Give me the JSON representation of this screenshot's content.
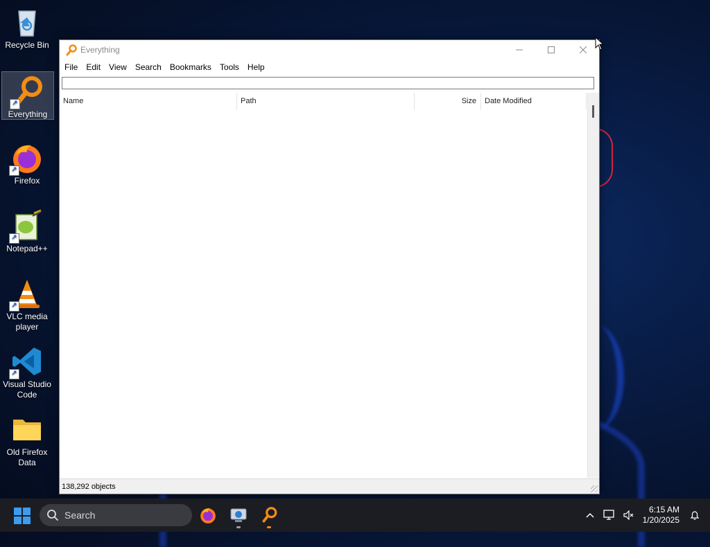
{
  "desktop": {
    "icons": [
      {
        "label": "Recycle Bin",
        "icon": "recycle-bin-icon"
      },
      {
        "label": "Everything",
        "icon": "everything-icon"
      },
      {
        "label": "Firefox",
        "icon": "firefox-icon"
      },
      {
        "label": "Notepad++",
        "icon": "notepadpp-icon"
      },
      {
        "label": "VLC media player",
        "icon": "vlc-icon"
      },
      {
        "label": "Visual Studio Code",
        "icon": "vscode-icon"
      },
      {
        "label": "Old Firefox Data",
        "icon": "folder-icon"
      }
    ]
  },
  "window": {
    "title": "Everything",
    "menu": [
      "File",
      "Edit",
      "View",
      "Search",
      "Bookmarks",
      "Tools",
      "Help"
    ],
    "search": {
      "value": "",
      "placeholder": ""
    },
    "columns": [
      "Name",
      "Path",
      "Size",
      "Date Modified"
    ],
    "status": "138,292 objects"
  },
  "taskbar": {
    "search_label": "Search",
    "apps": [
      "firefox-icon",
      "network-app-icon",
      "everything-icon"
    ],
    "time": "6:15 AM",
    "date": "1/20/2025"
  },
  "colors": {
    "accent": "#3c9cf0",
    "everything_orange": "#f28c14",
    "taskbar_bg": "#1b1d22"
  }
}
